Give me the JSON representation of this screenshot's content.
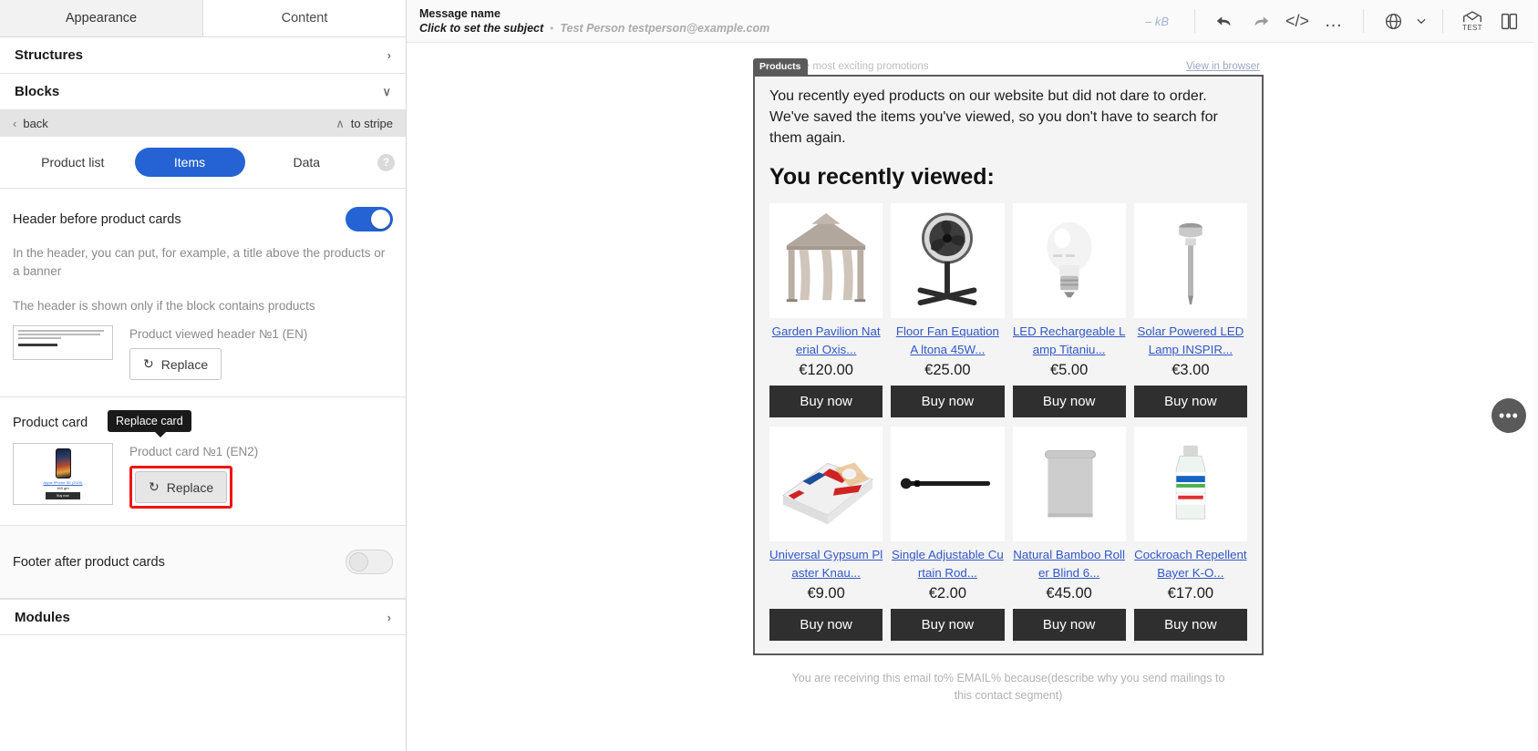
{
  "sidebar": {
    "tabs": [
      {
        "label": "Appearance",
        "active": true
      },
      {
        "label": "Content",
        "active": false
      }
    ],
    "accordions": [
      {
        "label": "Structures",
        "chevron": "›"
      },
      {
        "label": "Blocks",
        "chevron": "∨"
      }
    ],
    "backbar": {
      "back_label": "back",
      "back_icon": "‹",
      "to_stripe_label": "to stripe",
      "to_stripe_icon": "∧"
    },
    "segments": [
      {
        "label": "Product list",
        "active": false
      },
      {
        "label": "Items",
        "active": true
      },
      {
        "label": "Data",
        "active": false
      }
    ],
    "help_icon_label": "?",
    "header_section": {
      "title": "Header before product cards",
      "toggle_state": "on",
      "hint": "In the header, you can put, for example, a title above the products or a banner",
      "hint2": "The header is shown only if the block contains products",
      "asset_label": "Product viewed header №1 (EN)",
      "replace_label": "Replace",
      "thumb_text": "You recently viewed:"
    },
    "product_card_section": {
      "title": "Product card",
      "asset_label": "Product card №1 (EN2)",
      "replace_label": "Replace",
      "tooltip": "Replace card",
      "thumb_product_name": "Apple iPhone SE (2020)",
      "thumb_price": "169 grn",
      "thumb_button": "Buy now"
    },
    "footer_section": {
      "title": "Footer after product cards",
      "toggle_state": "off"
    },
    "modules": {
      "label": "Modules",
      "chevron": "›"
    }
  },
  "topbar": {
    "message_name": "Message name",
    "subject_placeholder": "Click to set the subject",
    "separator": "•",
    "sender": "Test Person testperson@example.com",
    "size": "– kB",
    "icons": [
      {
        "name": "undo-icon",
        "glyph": "←"
      },
      {
        "name": "redo-icon",
        "glyph": "→"
      },
      {
        "name": "code-icon",
        "glyph": "</>"
      },
      {
        "name": "more-icon",
        "glyph": "…"
      },
      {
        "name": "language-globe-icon",
        "glyph": "⊕"
      },
      {
        "name": "chevron-down-icon",
        "glyph": "∨"
      },
      {
        "name": "test-send-icon",
        "glyph": "TEST"
      },
      {
        "name": "preview-devices-icon",
        "glyph": "▣"
      }
    ]
  },
  "email": {
    "block_badge": "Products",
    "preheader": "...der of the most exciting promotions",
    "view_in_browser": "View in browser",
    "intro": "You recently eyed products on our website but did not dare to order. We've saved the items you've viewed, so you don't have to search for them again.",
    "headline": "You recently viewed:",
    "buy_label": "Buy now",
    "footer": "You are receiving this email to% EMAIL% because(describe why you send mailings to this contact segment)",
    "products": [
      {
        "name": "Garden Pavilion Nat erial Oxis...",
        "price": "€120.00",
        "image": "pavilion"
      },
      {
        "name": "Floor Fan Equation A ltona 45W...",
        "price": "€25.00",
        "image": "fan"
      },
      {
        "name": "LED Rechargeable L amp Titaniu...",
        "price": "€5.00",
        "image": "bulb"
      },
      {
        "name": "Solar Powered LED Lamp INSPIR...",
        "price": "€3.00",
        "image": "solar-lamp"
      },
      {
        "name": "Universal Gypsum Pl aster Knau...",
        "price": "€9.00",
        "image": "plaster-bag"
      },
      {
        "name": "Single Adjustable Cu rtain Rod...",
        "price": "€2.00",
        "image": "curtain-rod"
      },
      {
        "name": "Natural Bamboo Roll er Blind 6...",
        "price": "€45.00",
        "image": "roller-blind"
      },
      {
        "name": "Cockroach Repellent Bayer K-O...",
        "price": "€17.00",
        "image": "repellent-bottle"
      }
    ]
  },
  "fab": {
    "glyph": "•••"
  },
  "colors": {
    "accent": "#2563d4",
    "link": "#3157c7",
    "button_dark": "#2f2f2f",
    "highlight": "#f11414",
    "badge": "#5a5a5a"
  }
}
